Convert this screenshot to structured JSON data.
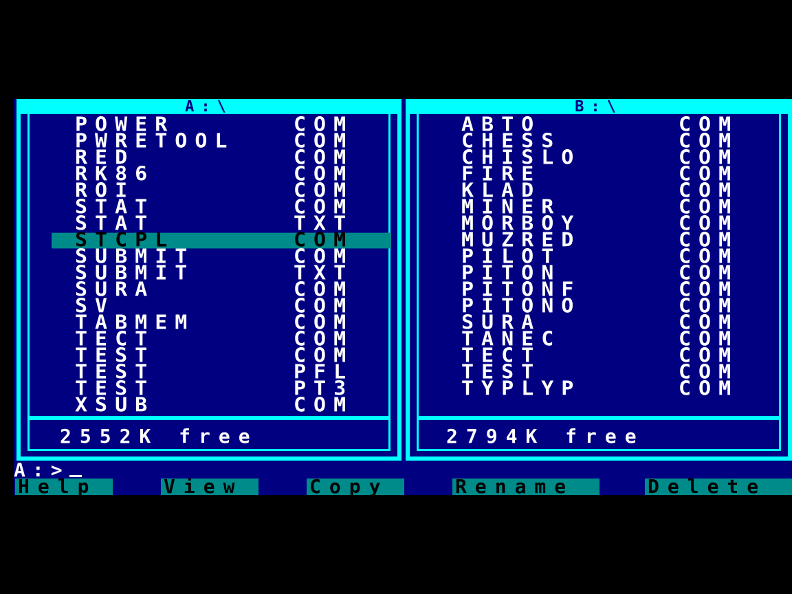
{
  "panel_a": {
    "title": "A:\\",
    "files": [
      {
        "name": "POWER",
        "ext": "COM"
      },
      {
        "name": "PWRETOOL",
        "ext": "COM"
      },
      {
        "name": "RED",
        "ext": "COM"
      },
      {
        "name": "RK86",
        "ext": "COM"
      },
      {
        "name": "ROI",
        "ext": "COM"
      },
      {
        "name": "STAT",
        "ext": "COM"
      },
      {
        "name": "STAT",
        "ext": "TXT"
      },
      {
        "name": "STCPL",
        "ext": "COM"
      },
      {
        "name": "SUBMIT",
        "ext": "COM"
      },
      {
        "name": "SUBMIT",
        "ext": "TXT"
      },
      {
        "name": "SURA",
        "ext": "COM"
      },
      {
        "name": "SV",
        "ext": "COM"
      },
      {
        "name": "TABMEM",
        "ext": "COM"
      },
      {
        "name": "TECT",
        "ext": "COM"
      },
      {
        "name": "TEST",
        "ext": "COM"
      },
      {
        "name": "TEST",
        "ext": "PFL"
      },
      {
        "name": "TEST",
        "ext": "PT3"
      },
      {
        "name": "XSUB",
        "ext": "COM"
      }
    ],
    "selected_index": 7,
    "free": "2552K free"
  },
  "panel_b": {
    "title": "B:\\",
    "files": [
      {
        "name": "ABTO",
        "ext": "COM"
      },
      {
        "name": "CHESS",
        "ext": "COM"
      },
      {
        "name": "CHISLO",
        "ext": "COM"
      },
      {
        "name": "FIRE",
        "ext": "COM"
      },
      {
        "name": "KLAD",
        "ext": "COM"
      },
      {
        "name": "MINER",
        "ext": "COM"
      },
      {
        "name": "MORBOY",
        "ext": "COM"
      },
      {
        "name": "MUZRED",
        "ext": "COM"
      },
      {
        "name": "PILOT",
        "ext": "COM"
      },
      {
        "name": "PITON",
        "ext": "COM"
      },
      {
        "name": "PITONF",
        "ext": "COM"
      },
      {
        "name": "PITONO",
        "ext": "COM"
      },
      {
        "name": "SURA",
        "ext": "COM"
      },
      {
        "name": "TANEC",
        "ext": "COM"
      },
      {
        "name": "TECT",
        "ext": "COM"
      },
      {
        "name": "TEST",
        "ext": "COM"
      },
      {
        "name": "TYPLYP",
        "ext": "COM"
      }
    ],
    "free": "2794K free"
  },
  "prompt": "A:>",
  "function_keys": [
    "Help",
    "View",
    "Copy",
    "Rename",
    "Delete"
  ],
  "colors": {
    "background": "#000080",
    "frame": "#00ffff",
    "highlight": "#008b8b",
    "text": "#ffffff"
  }
}
